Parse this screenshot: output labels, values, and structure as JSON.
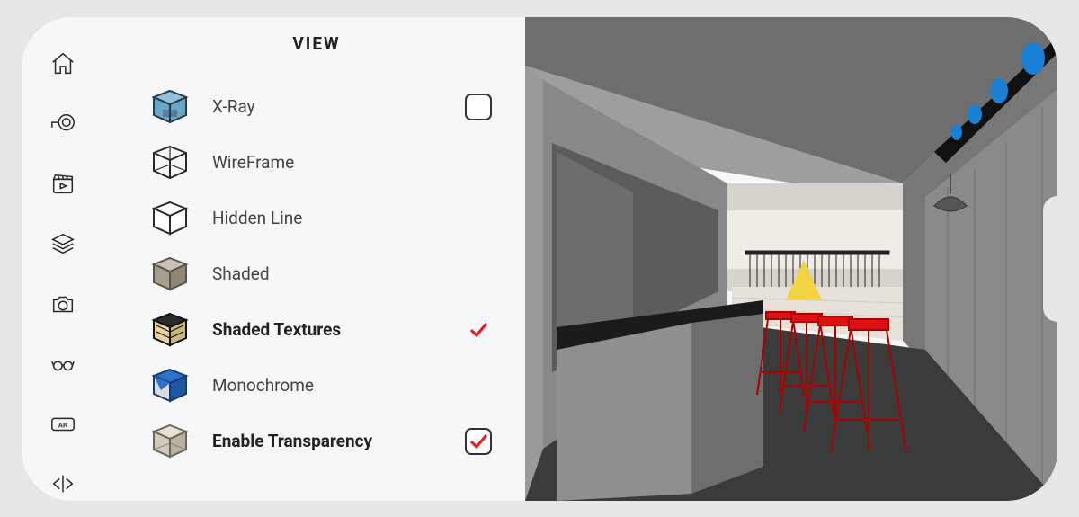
{
  "panel": {
    "title": "VIEW",
    "options": [
      {
        "label": "X-Ray"
      },
      {
        "label": "WireFrame"
      },
      {
        "label": "Hidden Line"
      },
      {
        "label": "Shaded"
      },
      {
        "label": "Shaded Textures"
      },
      {
        "label": "Monochrome"
      },
      {
        "label": "Enable Transparency"
      }
    ]
  }
}
